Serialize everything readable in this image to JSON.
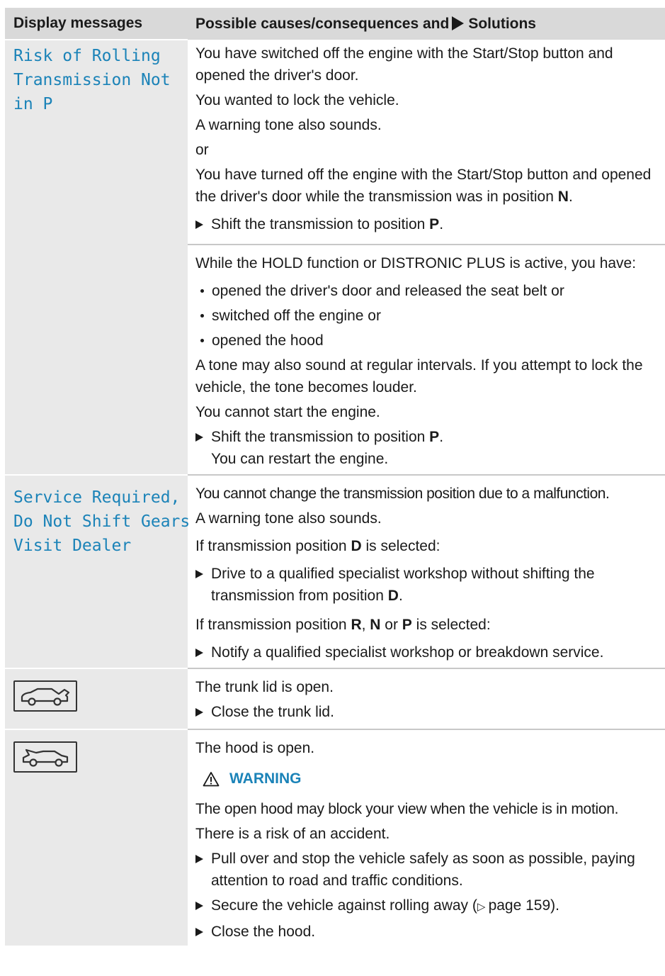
{
  "table": {
    "header": {
      "col1": "Display messages",
      "col2_before": "Possible causes/consequences and",
      "col2_after": "Solutions"
    },
    "rows": {
      "risk": {
        "display": "Risk of Rolling\nTransmission Not\nin P",
        "block1": {
          "p1": "You have switched off the engine with the Start/Stop button and opened the driver's door.",
          "p2": "You wanted to lock the vehicle.",
          "p3": "A warning tone also sounds.",
          "or": "or",
          "p4_text": "You have turned off the engine with the Start/Stop button and opened the driver's door while the transmission was in position",
          "p4_bold": "N",
          "p4_end": ".",
          "step_text": "Shift the transmission to position",
          "step_bold": "P",
          "step_end": "."
        },
        "block2": {
          "intro": "While the HOLD function or DISTRONIC PLUS is active, you have:",
          "bullets": [
            "opened the driver's door and released the seat belt or",
            "switched off the engine or",
            "opened the hood"
          ],
          "p1": "A tone may also sound at regular intervals. If you attempt to lock the vehicle, the tone becomes louder.",
          "p2": "You cannot start the engine.",
          "step_text": "Shift the transmission to position",
          "step_bold": "P",
          "step_end": ".",
          "step_line2": "You can restart the engine."
        }
      },
      "service": {
        "display": "Service Required,\nDo Not Shift Gears\nVisit Dealer",
        "p1": "You cannot change the transmission position due to a malfunction.",
        "p2": "A warning tone also sounds.",
        "p3_text": "If transmission position",
        "p3_bold": "D",
        "p3_end": "is selected:",
        "step1_text": "Drive to a qualified specialist workshop without shifting the transmission from position",
        "step1_bold": "D",
        "step1_end": ".",
        "p4_text": "If transmission position",
        "p4_b1": "R",
        "p4_sep1": ", ",
        "p4_b2": "N",
        "p4_sep2": " or ",
        "p4_b3": "P",
        "p4_end": " is selected:",
        "step2": "Notify a qualified specialist workshop or breakdown service."
      },
      "trunk": {
        "icon": "trunk-open-icon",
        "p1": "The trunk lid is open.",
        "step": "Close the trunk lid."
      },
      "hood": {
        "icon": "hood-open-icon",
        "p1": "The hood is open.",
        "warning": "WARNING",
        "p2": "The open hood may block your view when the vehicle is in motion.",
        "p3": "There is a risk of an accident.",
        "step1": "Pull over and stop the vehicle safely as soon as possible, paying attention to road and traffic conditions.",
        "step2_text": "Secure the vehicle against rolling away (",
        "step2_ref": "page 159",
        "step2_end": ").",
        "step3": "Close the hood."
      }
    }
  },
  "colors": {
    "accent": "#1b83b8",
    "header_bg": "#d9d9d9",
    "left_bg": "#e9e9e9"
  }
}
